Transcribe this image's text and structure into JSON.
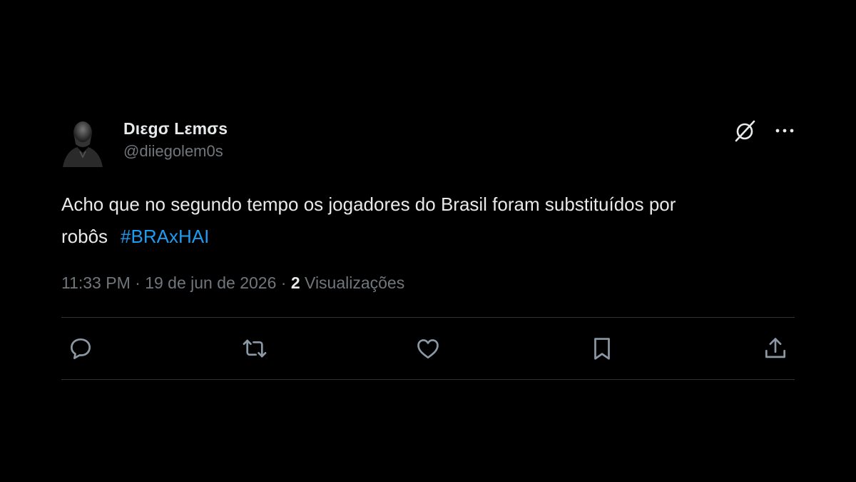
{
  "author": {
    "display_name": "Dιεgσ Lεmσs",
    "handle": "@diiegolem0s"
  },
  "header_icons": {
    "grok": "grok-icon",
    "more": "more-icon"
  },
  "tweet": {
    "text": "Acho que no segundo tempo os jogadores do Brasil foram substituídos por robôs",
    "hashtag": "#BRAxHAI"
  },
  "meta": {
    "time": "11:33 PM",
    "separator": "·",
    "date": "19 de jun de 2026",
    "views_count": "2",
    "views_label": "Visualizações"
  },
  "actions": [
    {
      "icon": "reply-icon"
    },
    {
      "icon": "retweet-icon"
    },
    {
      "icon": "like-icon"
    },
    {
      "icon": "bookmark-icon"
    },
    {
      "icon": "share-icon"
    }
  ],
  "colors": {
    "background": "#000000",
    "text": "#e7e9ea",
    "muted": "#71767b",
    "link": "#1d9bf0",
    "divider": "#2f3336"
  }
}
